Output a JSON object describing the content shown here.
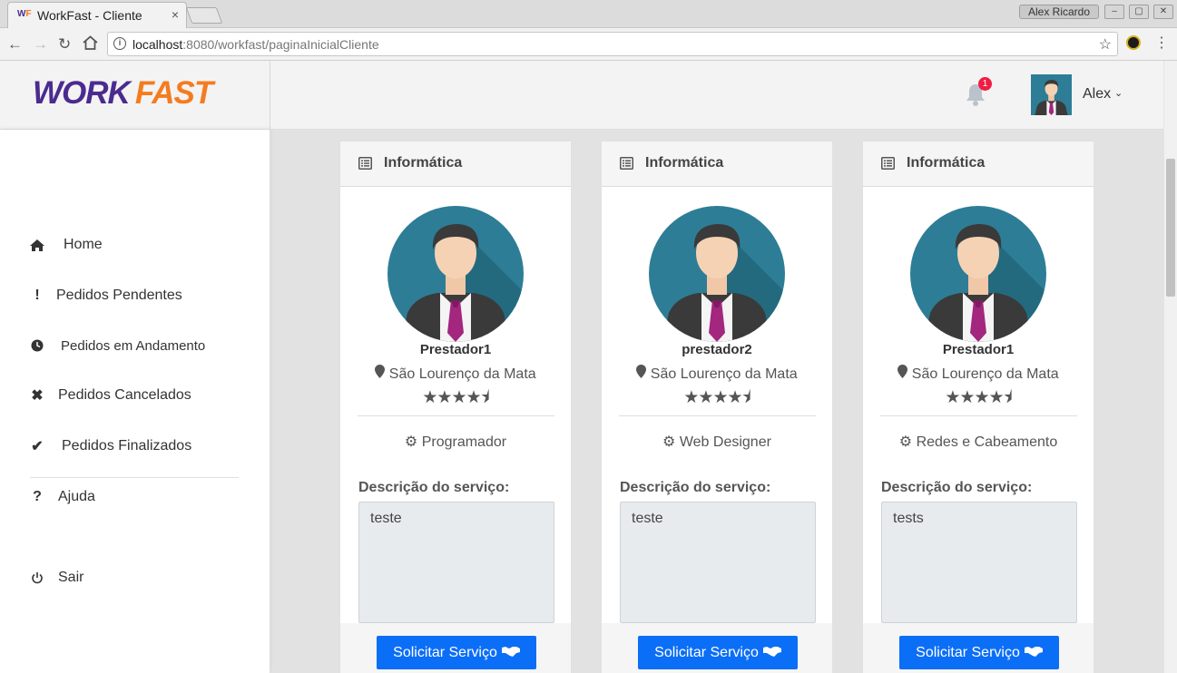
{
  "browser": {
    "tab_title": "WorkFast - Cliente",
    "tab_favicon_w": "W",
    "tab_favicon_f": "F",
    "tab_close": "×",
    "profile": "Alex Ricardo",
    "url_host": "localhost",
    "url_path": ":8080/workfast/paginaInicialCliente",
    "win_minimize": "–",
    "win_maximize": "▢",
    "win_close": "✕"
  },
  "brand": {
    "work": "WORK",
    "fast": "FAST"
  },
  "header": {
    "notification_count": "1",
    "user_name": "Alex",
    "caret": "⌄"
  },
  "sidebar": {
    "items": [
      {
        "label": "Home",
        "icon": "home-icon",
        "glyph": "⌂"
      },
      {
        "label": "Pedidos Pendentes",
        "icon": "exclamation-icon",
        "glyph": "!"
      },
      {
        "label": "Pedidos em Andamento",
        "icon": "clock-icon",
        "glyph": "◷"
      },
      {
        "label": "Pedidos Cancelados",
        "icon": "times-icon",
        "glyph": "✖"
      },
      {
        "label": "Pedidos Finalizados",
        "icon": "check-icon",
        "glyph": "✔"
      },
      {
        "label": "Ajuda",
        "icon": "question-icon",
        "glyph": "?"
      },
      {
        "label": "Sair",
        "icon": "power-icon",
        "glyph": "⏻"
      }
    ]
  },
  "cards": [
    {
      "category": "Informática",
      "name": "Prestador1",
      "location": "São Lourenço da Mata",
      "rating": 4.5,
      "stars_text": "★★★★⯨",
      "profession": "Programador",
      "description_label": "Descrição do serviço:",
      "description": "teste",
      "button_label": "Solicitar Serviço",
      "location_glyph": "📍",
      "gears_glyph": "⚙"
    },
    {
      "category": "Informática",
      "name": "prestador2",
      "location": "São Lourenço da Mata",
      "rating": 4.5,
      "stars_text": "★★★★⯨",
      "profession": "Web Designer",
      "description_label": "Descrição do serviço:",
      "description": "teste",
      "button_label": "Solicitar Serviço",
      "location_glyph": "📍",
      "gears_glyph": "⚙"
    },
    {
      "category": "Informática",
      "name": "Prestador1",
      "location": "São Lourenço da Mata",
      "rating": 4.5,
      "stars_text": "★★★★⯨",
      "profession": "Redes e Cabeamento",
      "description_label": "Descrição do serviço:",
      "description": "tests",
      "button_label": "Solicitar Serviço",
      "location_glyph": "📍",
      "gears_glyph": "⚙"
    }
  ],
  "colors": {
    "brand_purple": "#4b2b8f",
    "brand_orange": "#f47c20",
    "primary_button": "#0b6ef7",
    "badge_red": "#ef1d42",
    "avatar_bg": "#2e7d96"
  }
}
